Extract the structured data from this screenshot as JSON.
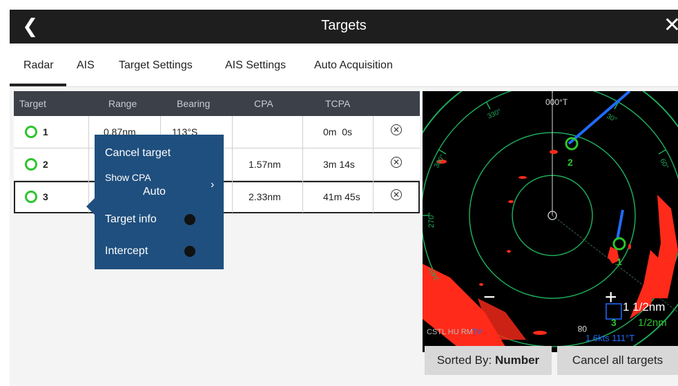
{
  "header": {
    "title": "Targets",
    "back_icon": "back-chevron-icon",
    "close_icon": "close-icon"
  },
  "tabs": [
    {
      "label": "Radar",
      "active": true
    },
    {
      "label": "AIS",
      "active": false
    },
    {
      "label": "Target Settings",
      "active": false
    },
    {
      "label": "AIS Settings",
      "active": false
    },
    {
      "label": "Auto Acquisition",
      "active": false
    }
  ],
  "table": {
    "columns": [
      "Target",
      "Range",
      "Bearing",
      "CPA",
      "TCPA"
    ],
    "rows": [
      {
        "number": "1",
        "range": "0.87nm",
        "bearing": "113°S",
        "cpa": "",
        "tcpa": "0m  0s"
      },
      {
        "number": "2",
        "range": "",
        "bearing": "",
        "cpa": "1.57nm",
        "tcpa": "3m 14s"
      },
      {
        "number": "3",
        "range": "",
        "bearing": "",
        "cpa": "2.33nm",
        "tcpa": "41m 45s"
      }
    ]
  },
  "popup": {
    "cancel_target": "Cancel target",
    "show_cpa": "Show CPA",
    "show_cpa_value": "Auto",
    "target_info": "Target info",
    "intercept": "Intercept"
  },
  "radar": {
    "heading": "000°T",
    "bearing_labels": {
      "b330": "330°",
      "b30": "30°",
      "b300": "300°",
      "b60": "60°",
      "b270": "270°",
      "b240": "240°"
    },
    "target_labels": [
      "1",
      "2",
      "3"
    ],
    "zoom_out": "−",
    "zoom_in": "+",
    "range": "1 1/2nm",
    "ring_range": "1/2nm",
    "modes": "CSTL HU RM",
    "mode_tv": "TV",
    "heading_readout": "08",
    "speed_readout": "1.6kts 111°T",
    "colors": {
      "ring": "#1faa5c",
      "echo": "#ff2a1a",
      "target": "#2ec42e",
      "vector": "#1f6bff"
    }
  },
  "footer": {
    "sorted_by_label": "Sorted By:",
    "sorted_by_value": "Number",
    "cancel_all": "Cancel all targets"
  }
}
